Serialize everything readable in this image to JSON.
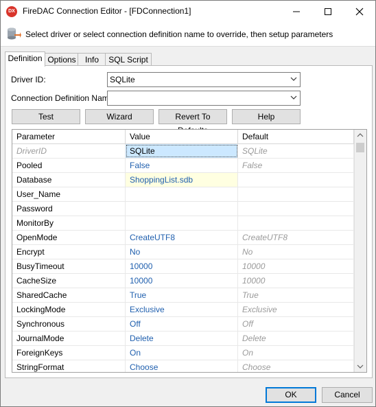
{
  "window": {
    "title": "FireDAC Connection Editor - [FDConnection1]",
    "icon_text": "DX",
    "controls": [
      "minimize-icon",
      "maximize-icon",
      "close-icon"
    ]
  },
  "header": {
    "description": "Select driver or select connection definition name to override, then setup parameters"
  },
  "tabs": [
    "Definition",
    "Options",
    "Info",
    "SQL Script"
  ],
  "definition": {
    "driver_label": "Driver ID:",
    "driver_value": "SQLite",
    "conn_def_label": "Connection Definition Name:",
    "conn_def_value": ""
  },
  "buttons": {
    "test": "Test",
    "wizard": "Wizard",
    "revert": "Revert To Defaults",
    "help": "Help"
  },
  "grid": {
    "columns": [
      "Parameter",
      "Value",
      "Default"
    ],
    "rows": [
      {
        "parameter": "DriverID",
        "value": "SQLite",
        "default": "SQLite"
      },
      {
        "parameter": "Pooled",
        "value": "False",
        "default": "False"
      },
      {
        "parameter": "Database",
        "value": "ShoppingList.sdb",
        "default": ""
      },
      {
        "parameter": "User_Name",
        "value": "",
        "default": ""
      },
      {
        "parameter": "Password",
        "value": "",
        "default": ""
      },
      {
        "parameter": "MonitorBy",
        "value": "",
        "default": ""
      },
      {
        "parameter": "OpenMode",
        "value": "CreateUTF8",
        "default": "CreateUTF8"
      },
      {
        "parameter": "Encrypt",
        "value": "No",
        "default": "No"
      },
      {
        "parameter": "BusyTimeout",
        "value": "10000",
        "default": "10000"
      },
      {
        "parameter": "CacheSize",
        "value": "10000",
        "default": "10000"
      },
      {
        "parameter": "SharedCache",
        "value": "True",
        "default": "True"
      },
      {
        "parameter": "LockingMode",
        "value": "Exclusive",
        "default": "Exclusive"
      },
      {
        "parameter": "Synchronous",
        "value": "Off",
        "default": "Off"
      },
      {
        "parameter": "JournalMode",
        "value": "Delete",
        "default": "Delete"
      },
      {
        "parameter": "ForeignKeys",
        "value": "On",
        "default": "On"
      },
      {
        "parameter": "StringFormat",
        "value": "Choose",
        "default": "Choose"
      }
    ]
  },
  "footer": {
    "ok": "OK",
    "cancel": "Cancel"
  }
}
